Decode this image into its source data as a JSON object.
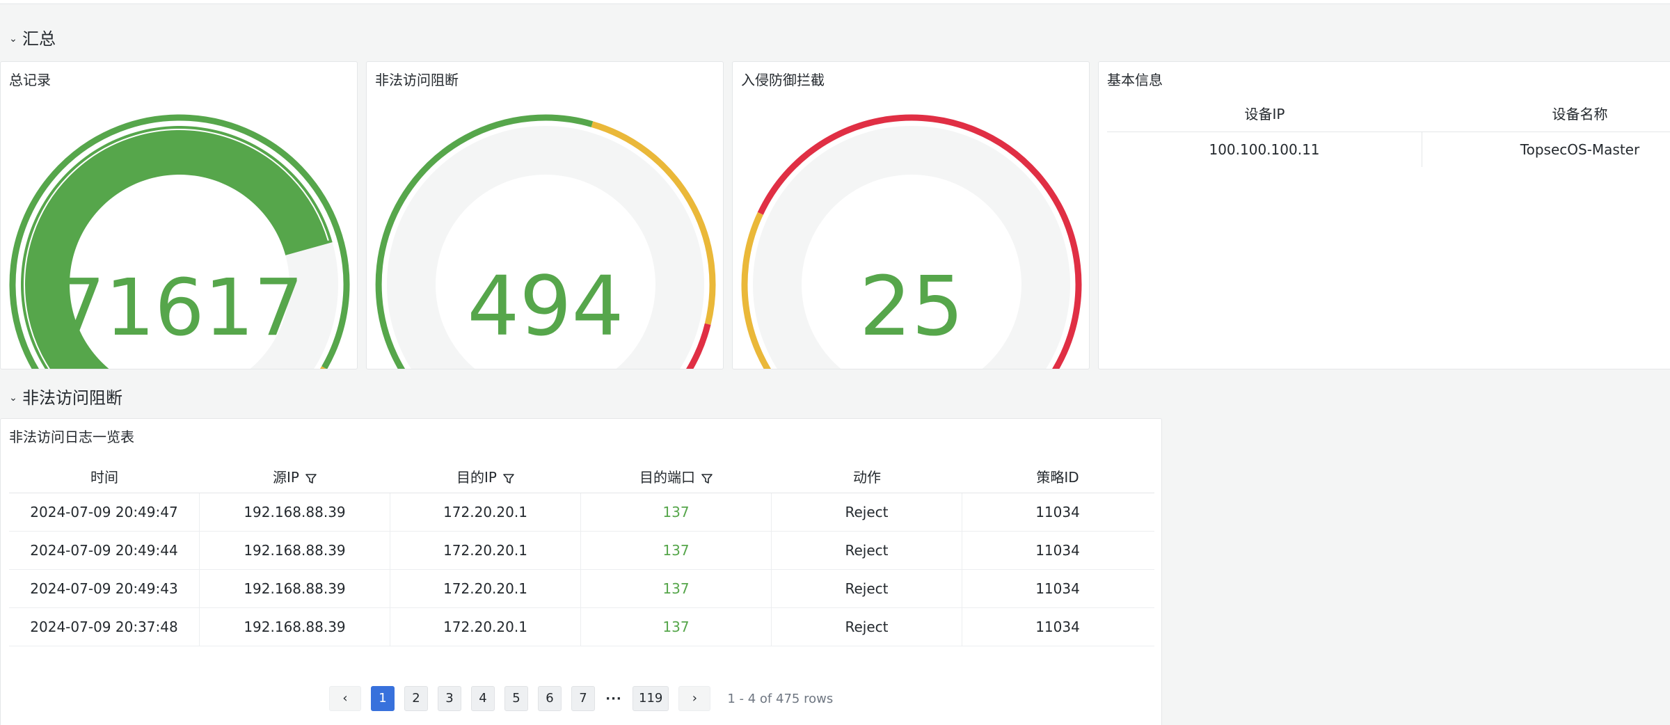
{
  "sections": {
    "summary": {
      "title": "汇总"
    },
    "illegal_access": {
      "title": "非法访问阻断"
    }
  },
  "gauges": [
    {
      "title": "总记录",
      "value": "71617",
      "level": 0.73,
      "value_color": "#56a64b",
      "thresholds": [
        {
          "from": 0,
          "to": 0.87,
          "color": "#56a64b"
        },
        {
          "from": 0.87,
          "to": 1,
          "color": "#eab839"
        }
      ],
      "fill_color": "#56a64b",
      "accent_indicator": true
    },
    {
      "title": "非法访问阻断",
      "value": "494",
      "level": 0.0,
      "value_color": "#56a64b",
      "thresholds": [
        {
          "from": 0,
          "to": 0.55,
          "color": "#56a64b"
        },
        {
          "from": 0.55,
          "to": 0.82,
          "color": "#eab839"
        },
        {
          "from": 0.82,
          "to": 1,
          "color": "#e02f44"
        }
      ],
      "fill_color": "#56a64b",
      "accent_indicator": false
    },
    {
      "title": "入侵防御拦截",
      "value": "25",
      "level": 0.055,
      "value_color": "#56a64b",
      "thresholds": [
        {
          "from": 0,
          "to": 0.1,
          "color": "#56a64b"
        },
        {
          "from": 0.1,
          "to": 0.3,
          "color": "#eab839"
        },
        {
          "from": 0.3,
          "to": 1,
          "color": "#e02f44"
        }
      ],
      "fill_color": "#56a64b",
      "accent_indicator": false
    }
  ],
  "info_panel": {
    "title": "基本信息",
    "columns": [
      "设备IP",
      "设备名称"
    ],
    "rows": [
      [
        "100.100.100.11",
        "TopsecOS-Master"
      ]
    ]
  },
  "log_panel": {
    "title": "非法访问日志一览表",
    "columns": [
      {
        "label": "时间",
        "filter": false
      },
      {
        "label": "源IP",
        "filter": true
      },
      {
        "label": "目的IP",
        "filter": true
      },
      {
        "label": "目的端口",
        "filter": true
      },
      {
        "label": "动作",
        "filter": false
      },
      {
        "label": "策略ID",
        "filter": false
      }
    ],
    "rows": [
      [
        "2024-07-09 20:49:47",
        "192.168.88.39",
        "172.20.20.1",
        "137",
        "Reject",
        "11034"
      ],
      [
        "2024-07-09 20:49:44",
        "192.168.88.39",
        "172.20.20.1",
        "137",
        "Reject",
        "11034"
      ],
      [
        "2024-07-09 20:49:43",
        "192.168.88.39",
        "172.20.20.1",
        "137",
        "Reject",
        "11034"
      ],
      [
        "2024-07-09 20:37:48",
        "192.168.88.39",
        "172.20.20.1",
        "137",
        "Reject",
        "11034"
      ]
    ]
  },
  "pagination": {
    "prev_icon": "‹",
    "next_icon": "›",
    "pages": [
      "1",
      "2",
      "3",
      "4",
      "5",
      "6",
      "7"
    ],
    "current": "1",
    "ellipsis": "···",
    "last": "119",
    "info": "1 - 4 of 475 rows"
  },
  "colors": {
    "green": "#56a64b",
    "yellow": "#eab839",
    "red": "#e02f44",
    "track": "#f4f5f5",
    "active_page": "#3871dc"
  }
}
